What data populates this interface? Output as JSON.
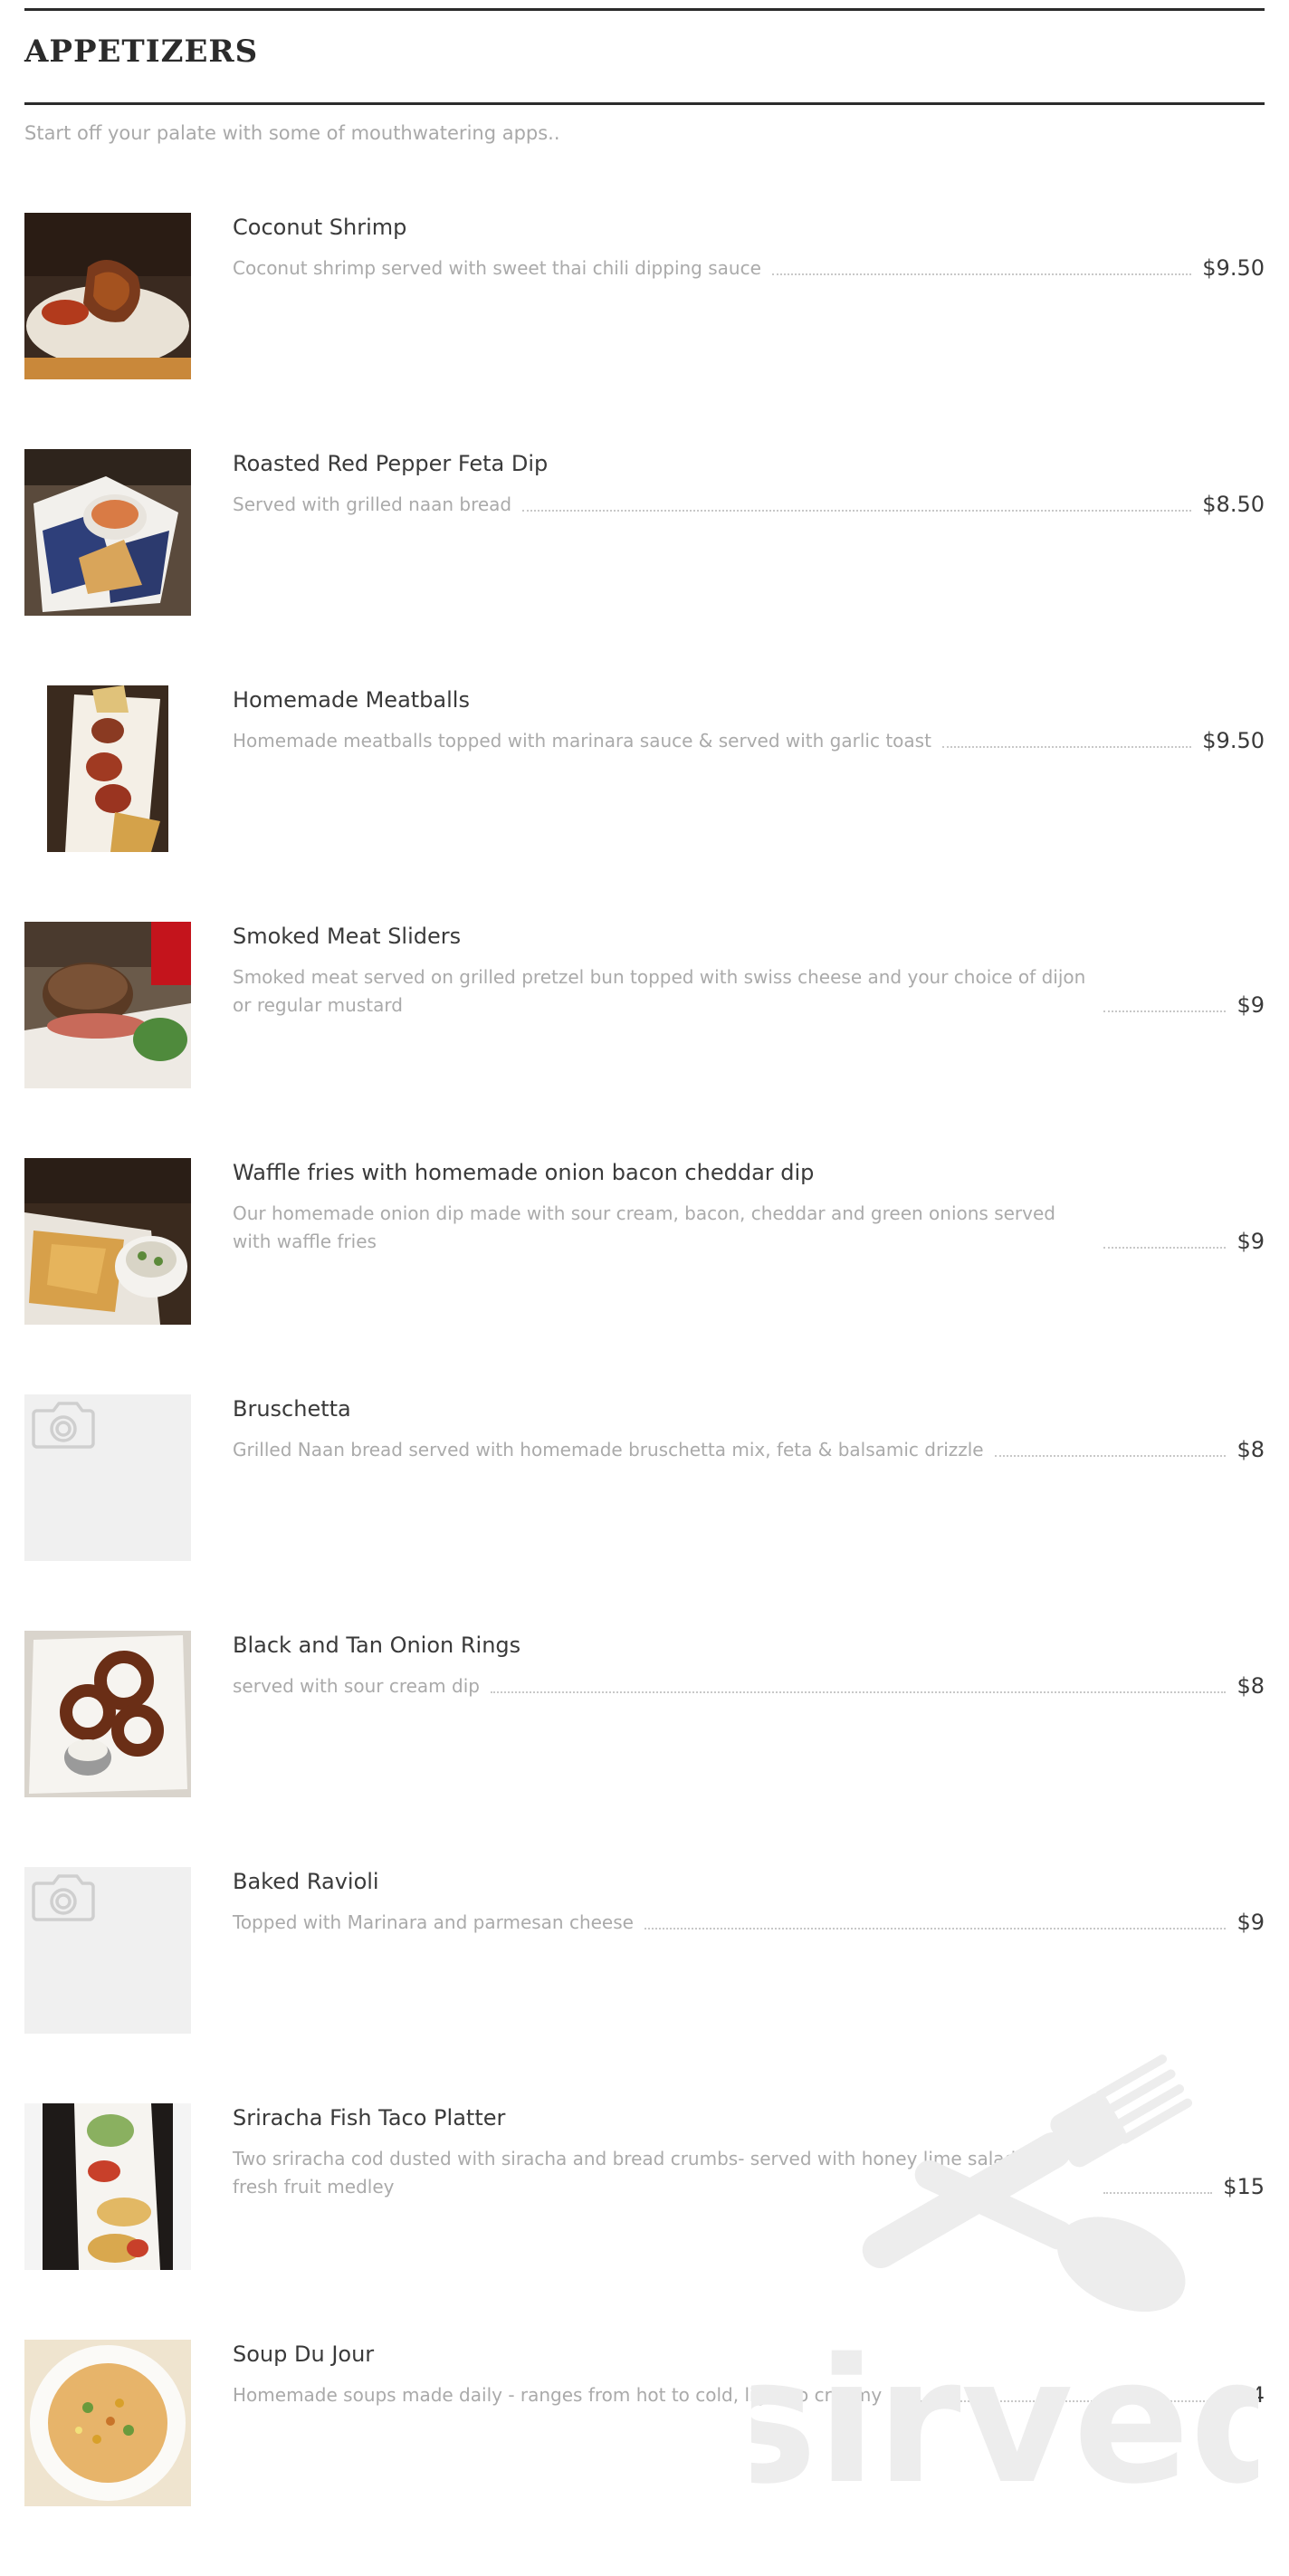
{
  "section": {
    "title": "APPETIZERS",
    "subtitle": "Start off your palate with some of mouthwatering apps.."
  },
  "items": [
    {
      "name": "Coconut Shrimp",
      "description": "Coconut shrimp served with sweet thai chili dipping sauce",
      "price": "$9.50",
      "image": "photo-shrimp"
    },
    {
      "name": "Roasted Red Pepper Feta Dip",
      "description": "Served with grilled naan bread",
      "price": "$8.50",
      "image": "photo-dip"
    },
    {
      "name": "Homemade Meatballs",
      "description": "Homemade meatballs topped with marinara sauce & served with garlic toast",
      "price": "$9.50",
      "image": "photo-meatballs"
    },
    {
      "name": "Smoked Meat Sliders",
      "description": "Smoked meat served on grilled pretzel bun topped with swiss cheese and your choice of dijon or regular mustard",
      "price": "$9",
      "image": "photo-sliders"
    },
    {
      "name": "Waffle fries with homemade onion bacon cheddar dip",
      "description": "Our homemade onion dip made with sour cream, bacon, cheddar and green onions served with waffle fries",
      "price": "$9",
      "image": "photo-fries"
    },
    {
      "name": "Bruschetta",
      "description": "Grilled Naan bread served with homemade bruschetta mix, feta & balsamic drizzle",
      "price": "$8",
      "image": "camera-placeholder-icon"
    },
    {
      "name": "Black and Tan Onion Rings",
      "description": "served with sour cream dip",
      "price": "$8",
      "image": "photo-onion-rings"
    },
    {
      "name": "Baked Ravioli",
      "description": "Topped with Marinara and parmesan cheese",
      "price": "$9",
      "image": "camera-placeholder-icon"
    },
    {
      "name": "Sriracha Fish Taco Platter",
      "description": "Two sriracha cod dusted with siracha and bread crumbs- served with honey lime salad and fresh fruit medley",
      "price": "$15",
      "image": "photo-tacos"
    },
    {
      "name": "Soup Du Jour",
      "description": "Homemade soups made daily - ranges from hot to cold, light to creamy",
      "price": "$4",
      "image": "photo-soup"
    }
  ],
  "watermark": {
    "text": "sirved",
    "icon": "fork-spoon-icon"
  },
  "colors": {
    "title": "#2b2b2b",
    "muted_text": "#aaaaaa",
    "price_text": "#3a3a3a",
    "placeholder_bg": "#f0f0f0",
    "watermark": "#ececec"
  }
}
